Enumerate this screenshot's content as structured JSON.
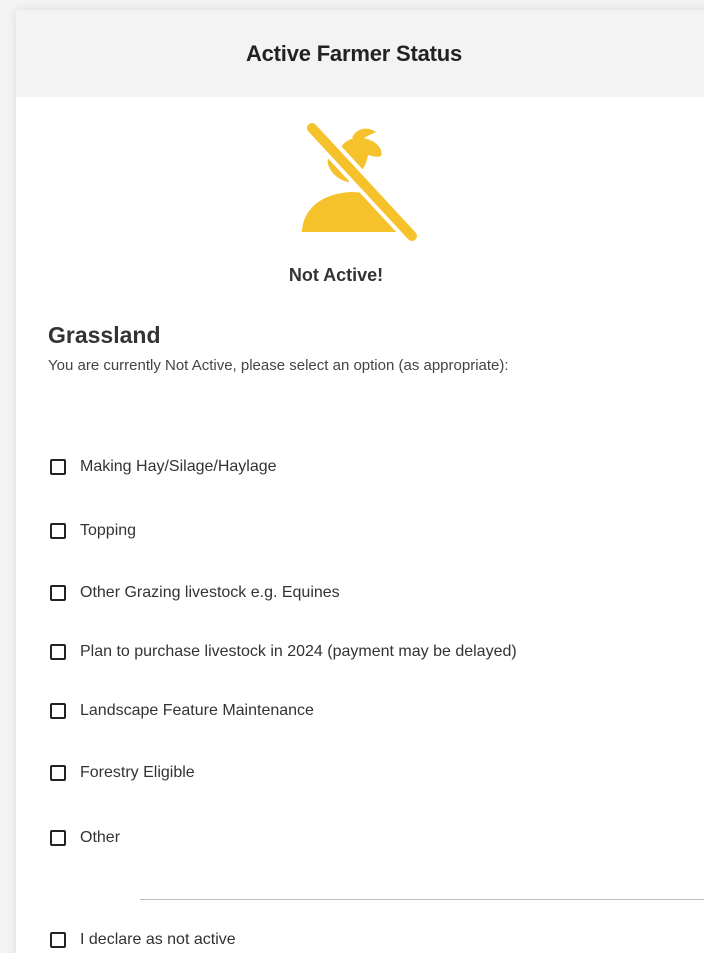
{
  "header": {
    "title": "Active Farmer Status"
  },
  "status": {
    "icon": "not-active-farmer-icon",
    "text": "Not Active!",
    "icon_color": "#f5c22b"
  },
  "grassland": {
    "title": "Grassland",
    "instructions": "You are currently Not Active, please select an option (as appropriate):",
    "options": [
      {
        "label": "Making Hay/Silage/Haylage",
        "checked": false
      },
      {
        "label": "Topping",
        "checked": false
      },
      {
        "label": "Other Grazing livestock e.g. Equines",
        "checked": false
      },
      {
        "label": "Plan to purchase livestock in 2024 (payment may be delayed)",
        "checked": false
      },
      {
        "label": "Landscape Feature Maintenance",
        "checked": false
      },
      {
        "label": "Forestry Eligible",
        "checked": false
      },
      {
        "label": "Other",
        "checked": false
      }
    ]
  },
  "declaration": {
    "label": "I declare as not active",
    "checked": false
  }
}
